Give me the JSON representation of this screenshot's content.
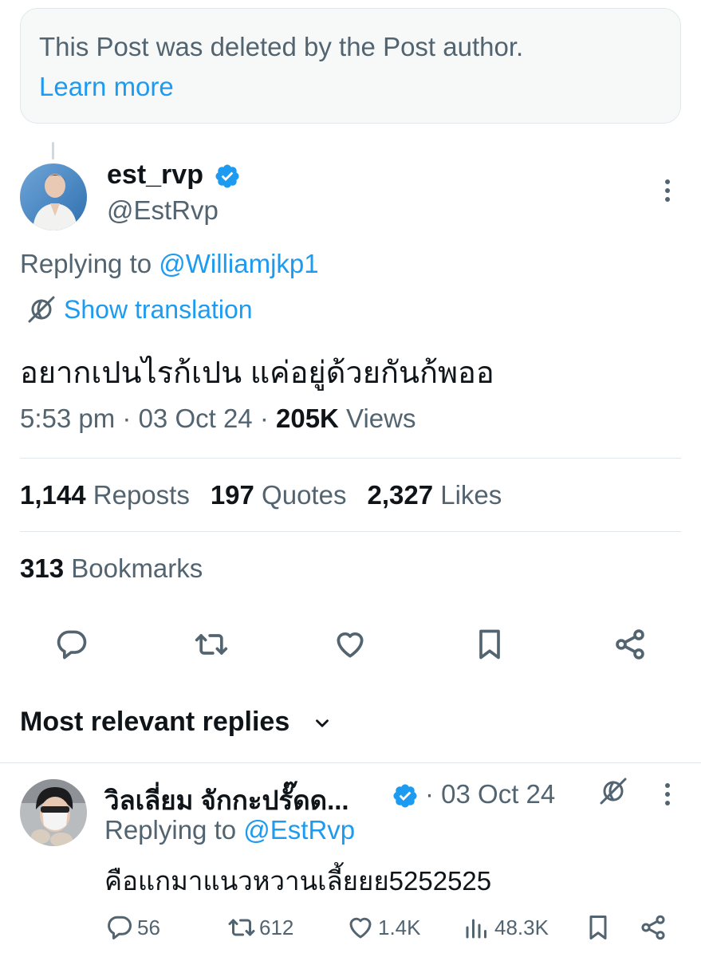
{
  "notice": {
    "text": "This Post was deleted by the Post author.",
    "link": "Learn more"
  },
  "post": {
    "display_name": "est_rvp",
    "handle": "@EstRvp",
    "replying_prefix": "Replying to ",
    "replying_to": "@Williamjkp1",
    "translate_label": "Show translation",
    "text": "อยากเปนไรก้เปน แค่อยู่ด้วยกันก้พออ",
    "time": "5:53 pm",
    "sep": " · ",
    "date": "03 Oct 24",
    "views_count": "205K",
    "views_label": " Views",
    "reposts_count": "1,144",
    "reposts_label": " Reposts",
    "quotes_count": "197",
    "quotes_label": " Quotes",
    "likes_count": "2,327",
    "likes_label": " Likes",
    "bookmarks_count": "313",
    "bookmarks_label": " Bookmarks"
  },
  "replies_header": "Most relevant replies",
  "reply": {
    "display_name": "วิลเลี่ยม จักกะปรั๊ดด...",
    "date": "· 03 Oct 24",
    "replying_prefix": "Replying to ",
    "replying_to": "@EstRvp",
    "text": "คือแกมาแนวหวานเลี้ยยย5252525",
    "replies": "56",
    "reposts": "612",
    "likes": "1.4K",
    "views": "48.3K"
  },
  "icons": {
    "verified": "verified-badge-icon",
    "more": "more-vertical-icon",
    "translate": "translate-icon",
    "reply": "reply-icon",
    "repost": "repost-icon",
    "like": "heart-icon",
    "bookmark": "bookmark-icon",
    "share": "share-icon",
    "views": "views-icon",
    "chevron": "chevron-down-icon"
  },
  "colors": {
    "accent": "#1d9bf0",
    "secondary_text": "#536471",
    "primary_text": "#0f1419",
    "border": "#e1e8ed",
    "notice_bg": "#f7f9f9"
  }
}
